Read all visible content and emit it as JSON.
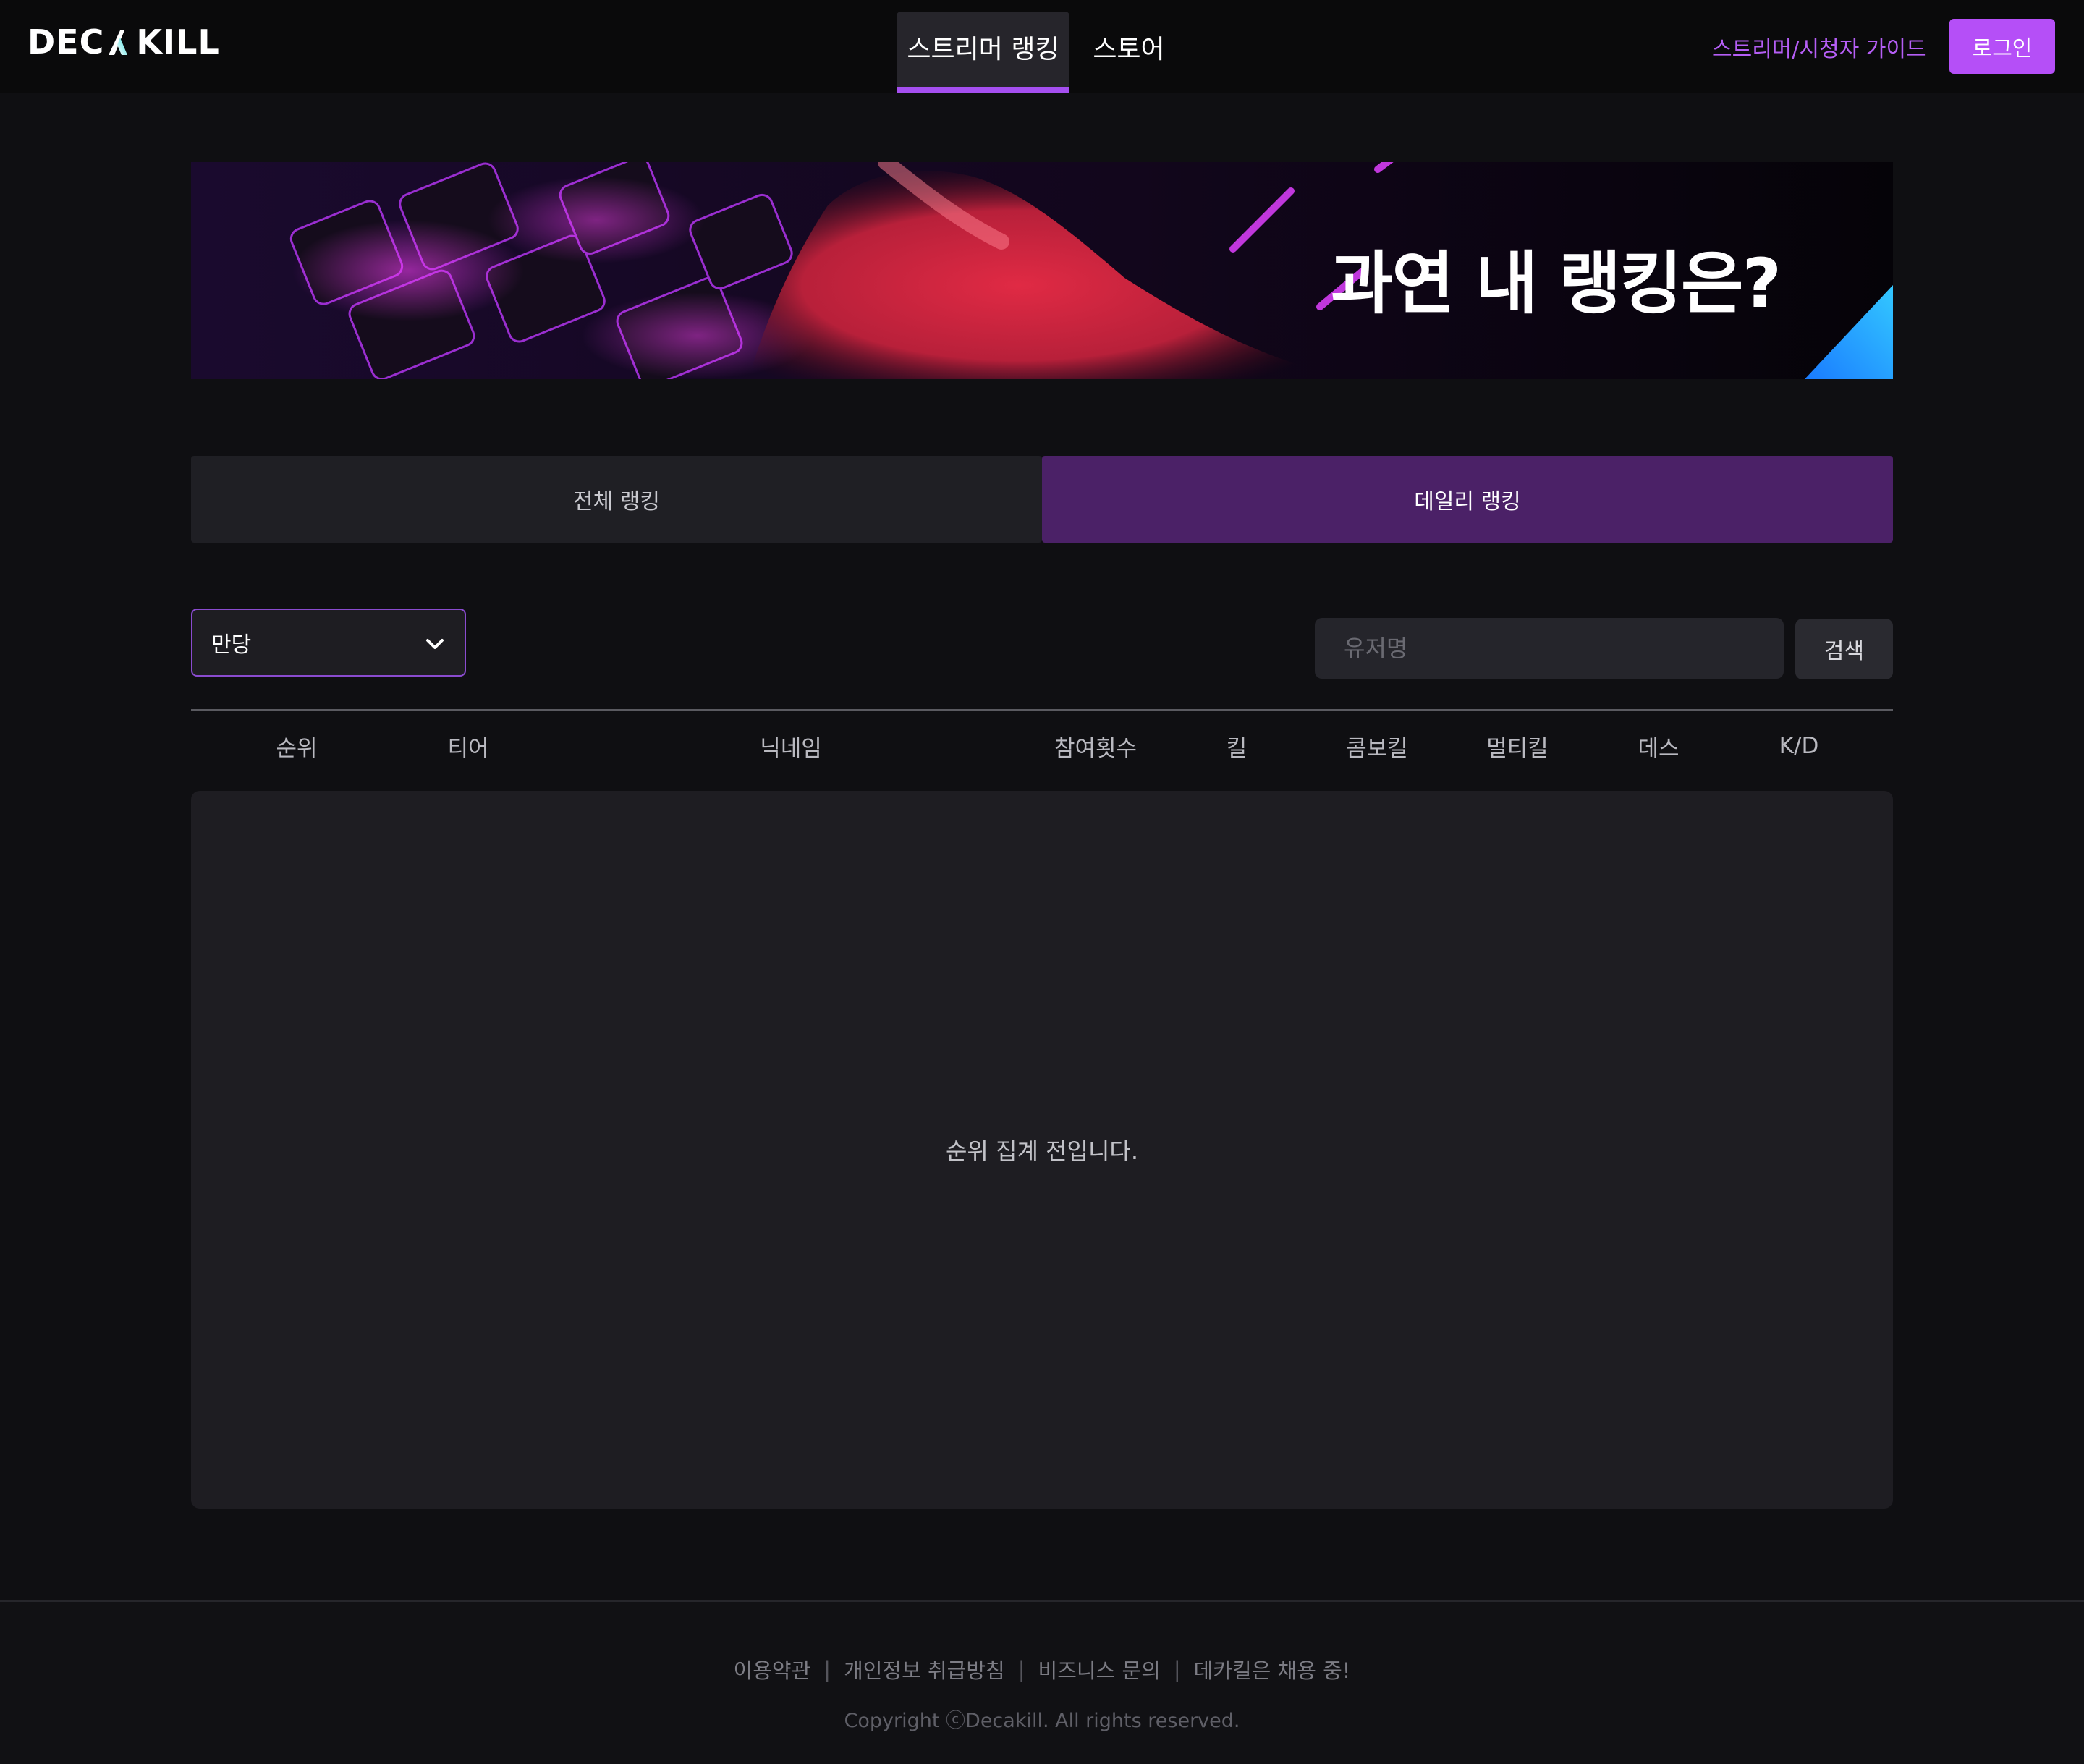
{
  "header": {
    "logo": {
      "left": "DEC",
      "right": "KILL"
    },
    "nav": [
      {
        "label": "스트리머 랭킹",
        "active": true
      },
      {
        "label": "스토어",
        "active": false
      }
    ],
    "guide_link": "스트리머/시청자 가이드",
    "login_label": "로그인"
  },
  "banner": {
    "text": "과연 내 랭킹은?"
  },
  "ranking_tabs": [
    {
      "label": "전체 랭킹",
      "active": false
    },
    {
      "label": "데일리 랭킹",
      "active": true
    }
  ],
  "filters": {
    "map_selected": "만당",
    "search_placeholder": "유저명",
    "search_button": "검색"
  },
  "table": {
    "columns": [
      "순위",
      "티어",
      "닉네임",
      "참여횟수",
      "킬",
      "콤보킬",
      "멀티킬",
      "데스",
      "K/D"
    ],
    "empty_message": "순위 집계 전입니다."
  },
  "footer": {
    "links": [
      "이용약관",
      "개인정보 취급방침",
      "비즈니스 문의",
      "데카킬은 채용 중!"
    ],
    "separator": "|",
    "copyright": "Copyright ⓒDecakill. All rights reserved."
  },
  "colors": {
    "accent": "#b54ff7",
    "active_tab": "#4b2167",
    "background": "#0f0f12",
    "panel": "#1e1d22"
  }
}
